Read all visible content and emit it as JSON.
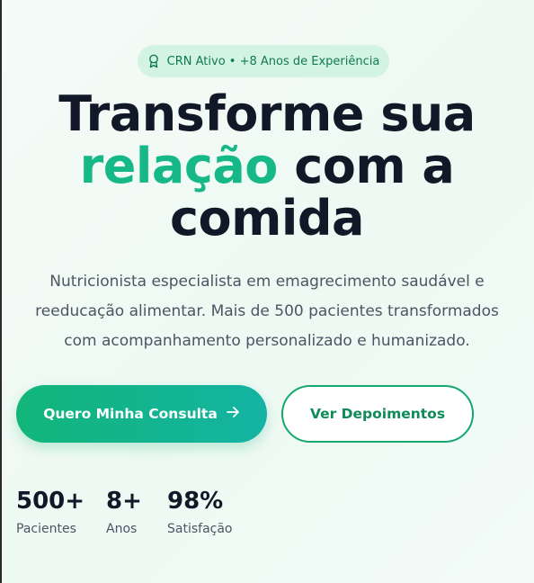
{
  "badge": {
    "icon": "award-icon",
    "text": "CRN Ativo • +8 Anos de Experiência"
  },
  "hero": {
    "line1": "Transforme sua",
    "highlight": "relação",
    "line2_rest": "com a",
    "line3": "comida",
    "description_lines": [
      "Nutricionista especialista em emagrecimento saudável e",
      "reeducação alimentar. Mais de 500 pacientes transformados",
      "com acompanhamento personalizado e humanizado."
    ]
  },
  "buttons": {
    "primary_label": "Quero Minha Consulta",
    "primary_icon": "arrow-right-icon",
    "secondary_label": "Ver Depoimentos"
  },
  "stats": [
    {
      "value": "500+",
      "label": "Pacientes"
    },
    {
      "value": "8+",
      "label": "Anos"
    },
    {
      "value": "98%",
      "label": "Satisfação"
    }
  ],
  "colors": {
    "accent": "#15b886",
    "badge_bg": "#d4f4e3",
    "headline": "#111827"
  }
}
